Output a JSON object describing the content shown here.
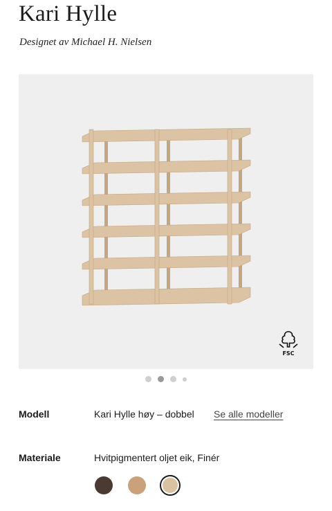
{
  "product": {
    "title": "Kari Hylle",
    "designer": "Designet av Michael H. Nielsen"
  },
  "gallery": {
    "badge_icon": "fsc-tree-icon",
    "badge_label": "FSC",
    "slide_count": 4,
    "active_slide": 2
  },
  "model": {
    "label": "Modell",
    "value": "Kari Hylle høy – dobbel",
    "link_label": "Se alle modeller"
  },
  "material": {
    "label": "Materiale",
    "value": "Hvitpigmentert oljet eik, Finér",
    "swatches": [
      {
        "name": "dark-oak",
        "color": "#4a3a32",
        "selected": false
      },
      {
        "name": "oak",
        "color": "#c9a27c",
        "selected": false
      },
      {
        "name": "white-oak",
        "color": "#d9c2a2",
        "selected": true
      }
    ]
  },
  "colors": {
    "image_background": "#efefef",
    "wood": "#dcc3a3",
    "wood_dark": "#c4a683"
  }
}
